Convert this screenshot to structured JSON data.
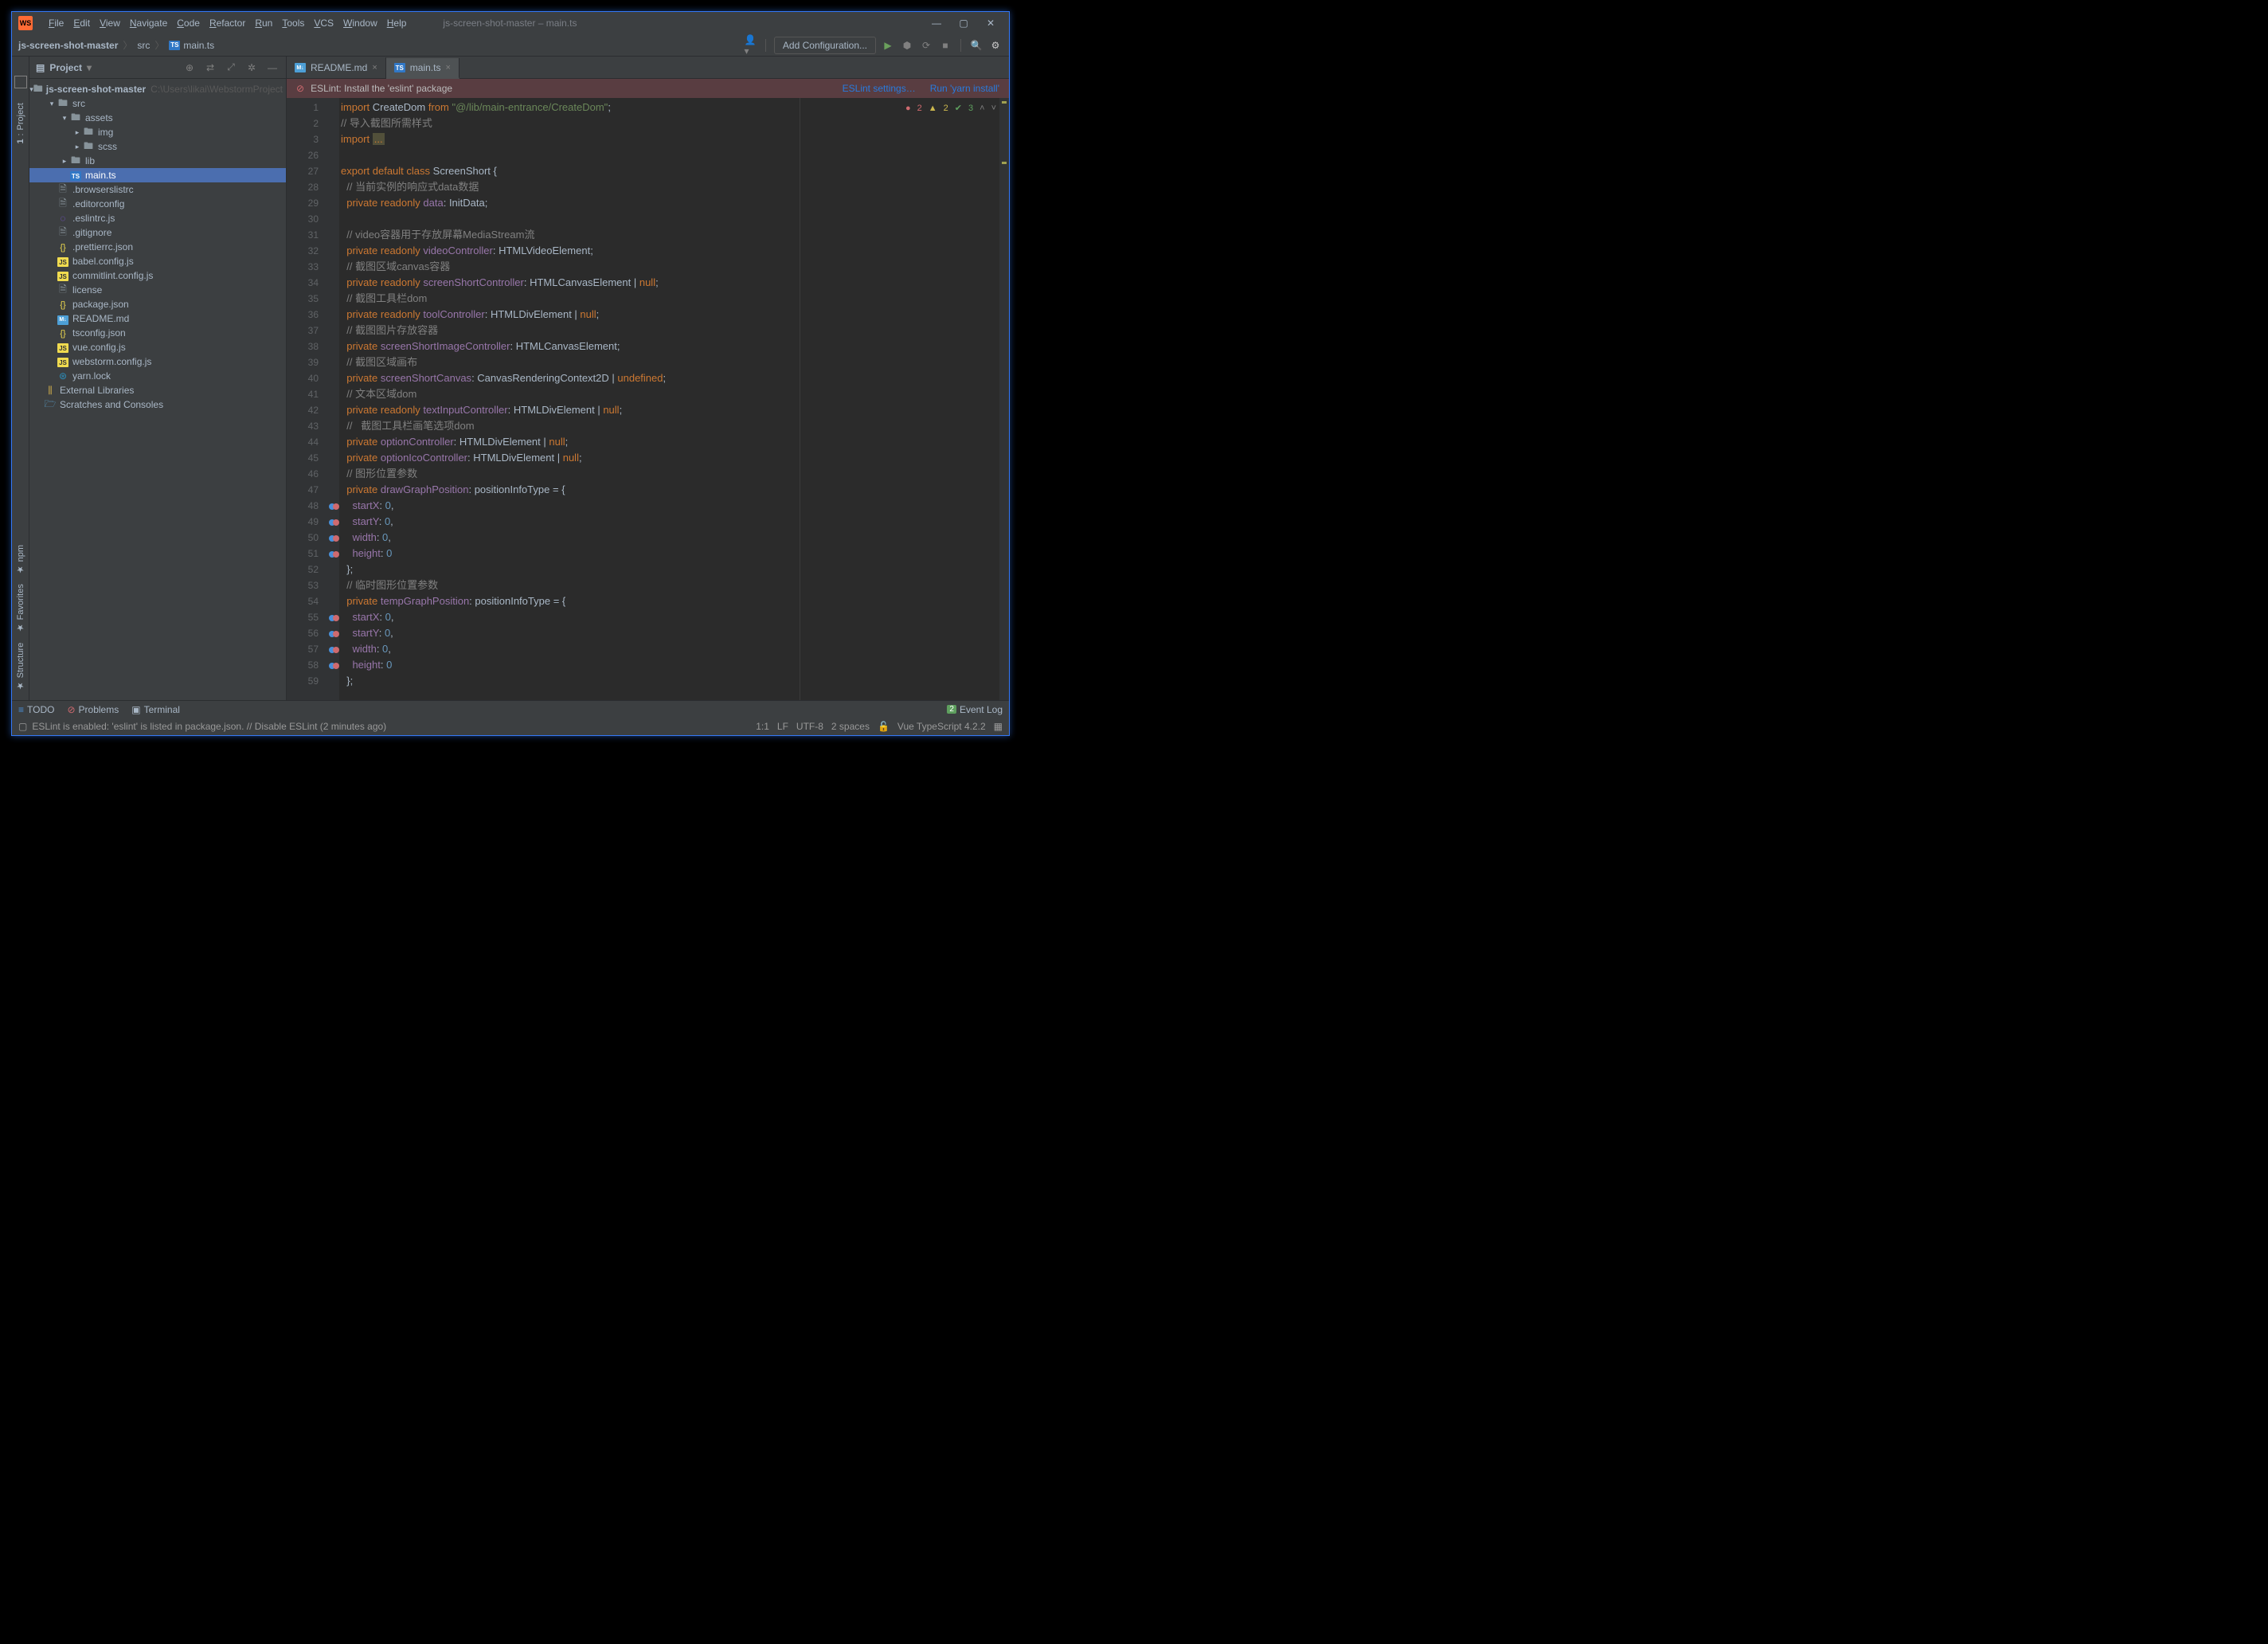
{
  "app": {
    "icon_text": "WS",
    "title": "js-screen-shot-master – main.ts"
  },
  "menu": [
    "File",
    "Edit",
    "View",
    "Navigate",
    "Code",
    "Refactor",
    "Run",
    "Tools",
    "VCS",
    "Window",
    "Help"
  ],
  "window_controls": {
    "min": "—",
    "max": "▢",
    "close": "✕"
  },
  "breadcrumb": [
    {
      "label": "js-screen-shot-master",
      "bold": true
    },
    {
      "label": "src"
    },
    {
      "label": "main.ts",
      "icon": "ts"
    }
  ],
  "nav_right": {
    "config": "Add Configuration..."
  },
  "project_panel": {
    "title": "Project",
    "tree": [
      {
        "depth": 0,
        "arrow": "▾",
        "icon": "folder",
        "label": "js-screen-shot-master",
        "bold": true,
        "path": "C:\\Users\\likai\\WebstormProject"
      },
      {
        "depth": 1,
        "arrow": "▾",
        "icon": "folder",
        "label": "src"
      },
      {
        "depth": 2,
        "arrow": "▾",
        "icon": "folder",
        "label": "assets"
      },
      {
        "depth": 3,
        "arrow": "▸",
        "icon": "folder",
        "label": "img"
      },
      {
        "depth": 3,
        "arrow": "▸",
        "icon": "folder",
        "label": "scss"
      },
      {
        "depth": 2,
        "arrow": "▸",
        "icon": "folder",
        "label": "lib"
      },
      {
        "depth": 2,
        "arrow": "",
        "icon": "ts",
        "label": "main.ts",
        "selected": true
      },
      {
        "depth": 1,
        "arrow": "",
        "icon": "file",
        "label": ".browserslistrc"
      },
      {
        "depth": 1,
        "arrow": "",
        "icon": "file",
        "label": ".editorconfig"
      },
      {
        "depth": 1,
        "arrow": "",
        "icon": "eslint",
        "label": ".eslintrc.js"
      },
      {
        "depth": 1,
        "arrow": "",
        "icon": "file",
        "label": ".gitignore"
      },
      {
        "depth": 1,
        "arrow": "",
        "icon": "json",
        "label": ".prettierrc.json"
      },
      {
        "depth": 1,
        "arrow": "",
        "icon": "js",
        "label": "babel.config.js"
      },
      {
        "depth": 1,
        "arrow": "",
        "icon": "js",
        "label": "commitlint.config.js"
      },
      {
        "depth": 1,
        "arrow": "",
        "icon": "file",
        "label": "license"
      },
      {
        "depth": 1,
        "arrow": "",
        "icon": "json",
        "label": "package.json"
      },
      {
        "depth": 1,
        "arrow": "",
        "icon": "md",
        "label": "README.md"
      },
      {
        "depth": 1,
        "arrow": "",
        "icon": "json",
        "label": "tsconfig.json"
      },
      {
        "depth": 1,
        "arrow": "",
        "icon": "js",
        "label": "vue.config.js"
      },
      {
        "depth": 1,
        "arrow": "",
        "icon": "js",
        "label": "webstorm.config.js"
      },
      {
        "depth": 1,
        "arrow": "",
        "icon": "yarn",
        "label": "yarn.lock"
      },
      {
        "depth": 0,
        "arrow": "",
        "icon": "lib",
        "label": "External Libraries"
      },
      {
        "depth": 0,
        "arrow": "",
        "icon": "scratch",
        "label": "Scratches and Consoles"
      }
    ]
  },
  "left_rail": {
    "top": "Project",
    "bottom": [
      "Structure",
      "Favorites",
      "npm"
    ]
  },
  "tabs": [
    {
      "label": "README.md",
      "icon": "md",
      "active": false
    },
    {
      "label": "main.ts",
      "icon": "ts",
      "active": true
    }
  ],
  "eslint_banner": {
    "icon": "⊘",
    "text": "ESLint: Install the 'eslint' package",
    "link1": "ESLint settings…",
    "link2": "Run 'yarn install'"
  },
  "inspections": {
    "errors": "2",
    "warnings": "2",
    "ok": "3"
  },
  "code_lines": [
    {
      "n": 1,
      "html": "<span class='kw'>import</span> <span class='cls'>CreateDom</span> <span class='kw'>from</span> <span class='str'>\"@/lib/main-entrance/CreateDom\"</span>;"
    },
    {
      "n": 2,
      "html": "<span class='cmt'>// 导入截图所需样式</span>"
    },
    {
      "n": 3,
      "html": "<span class='kw'>import</span> <span class='dots'>...</span>"
    },
    {
      "n": 26,
      "html": ""
    },
    {
      "n": 27,
      "html": "<span class='kw'>export default</span> <span class='kw'>class</span> <span class='cls'>ScreenShort</span> {"
    },
    {
      "n": 28,
      "html": "  <span class='cmt'>// 当前实例的响应式data数据</span>"
    },
    {
      "n": 29,
      "html": "  <span class='kw'>private</span> <span class='kw'>readonly</span> <span class='field'>data</span>: <span class='type'>InitData</span>;"
    },
    {
      "n": 30,
      "html": ""
    },
    {
      "n": 31,
      "html": "  <span class='cmt'>// video容器用于存放屏幕MediaStream流</span>"
    },
    {
      "n": 32,
      "html": "  <span class='kw'>private</span> <span class='kw'>readonly</span> <span class='field'>videoController</span>: <span class='type'>HTMLVideoElement</span>;"
    },
    {
      "n": 33,
      "html": "  <span class='cmt'>// 截图区域canvas容器</span>"
    },
    {
      "n": 34,
      "html": "  <span class='kw'>private</span> <span class='kw'>readonly</span> <span class='field'>screenShortController</span>: <span class='type'>HTMLCanvasElement</span> | <span class='kw'>null</span>;"
    },
    {
      "n": 35,
      "html": "  <span class='cmt'>// 截图工具栏dom</span>"
    },
    {
      "n": 36,
      "html": "  <span class='kw'>private</span> <span class='kw'>readonly</span> <span class='field'>toolController</span>: <span class='type'>HTMLDivElement</span> | <span class='kw'>null</span>;"
    },
    {
      "n": 37,
      "html": "  <span class='cmt'>// 截图图片存放容器</span>"
    },
    {
      "n": 38,
      "html": "  <span class='kw'>private</span> <span class='field'>screenShortImageController</span>: <span class='type'>HTMLCanvasElement</span>;"
    },
    {
      "n": 39,
      "html": "  <span class='cmt'>// 截图区域画布</span>"
    },
    {
      "n": 40,
      "html": "  <span class='kw'>private</span> <span class='field'>screenShortCanvas</span>: <span class='type'>CanvasRenderingContext2D</span> | <span class='kw'>undefined</span>;"
    },
    {
      "n": 41,
      "html": "  <span class='cmt'>// 文本区域dom</span>"
    },
    {
      "n": 42,
      "html": "  <span class='kw'>private</span> <span class='kw'>readonly</span> <span class='field'>textInputController</span>: <span class='type'>HTMLDivElement</span> | <span class='kw'>null</span>;"
    },
    {
      "n": 43,
      "html": "  <span class='cmt'>//   截图工具栏画笔选项dom</span>"
    },
    {
      "n": 44,
      "html": "  <span class='kw'>private</span> <span class='field'>optionController</span>: <span class='type'>HTMLDivElement</span> | <span class='kw'>null</span>;"
    },
    {
      "n": 45,
      "html": "  <span class='kw'>private</span> <span class='field'>optionIcoController</span>: <span class='type'>HTMLDivElement</span> | <span class='kw'>null</span>;"
    },
    {
      "n": 46,
      "html": "  <span class='cmt'>// 图形位置参数</span>"
    },
    {
      "n": 47,
      "html": "  <span class='kw'>private</span> <span class='field'>drawGraphPosition</span>: <span class='type'>positionInfoType</span> = {"
    },
    {
      "n": 48,
      "mark": "b",
      "html": "    <span class='field'>startX</span>: <span class='num'>0</span>,"
    },
    {
      "n": 49,
      "mark": "b",
      "html": "    <span class='field'>startY</span>: <span class='num'>0</span>,"
    },
    {
      "n": 50,
      "mark": "b",
      "html": "    <span class='field'>width</span>: <span class='num'>0</span>,"
    },
    {
      "n": 51,
      "mark": "b",
      "html": "    <span class='field'>height</span>: <span class='num'>0</span>"
    },
    {
      "n": 52,
      "html": "  };"
    },
    {
      "n": 53,
      "html": "  <span class='cmt'>// 临时图形位置参数</span>"
    },
    {
      "n": 54,
      "html": "  <span class='kw'>private</span> <span class='field'>tempGraphPosition</span>: <span class='type'>positionInfoType</span> = {"
    },
    {
      "n": 55,
      "mark": "b",
      "html": "    <span class='field'>startX</span>: <span class='num'>0</span>,"
    },
    {
      "n": 56,
      "mark": "b",
      "html": "    <span class='field'>startY</span>: <span class='num'>0</span>,"
    },
    {
      "n": 57,
      "mark": "b",
      "html": "    <span class='field'>width</span>: <span class='num'>0</span>,"
    },
    {
      "n": 58,
      "mark": "b",
      "html": "    <span class='field'>height</span>: <span class='num'>0</span>"
    },
    {
      "n": 59,
      "html": "  };"
    }
  ],
  "bottom_bar": {
    "todo": "TODO",
    "problems": "Problems",
    "terminal": "Terminal",
    "event_log": "Event Log"
  },
  "status_bar": {
    "message": "ESLint is enabled: 'eslint' is listed in package.json. // Disable ESLint (2 minutes ago)",
    "pos": "1:1",
    "eol": "LF",
    "encoding": "UTF-8",
    "indent": "2 spaces",
    "lang": "Vue TypeScript 4.2.2"
  }
}
